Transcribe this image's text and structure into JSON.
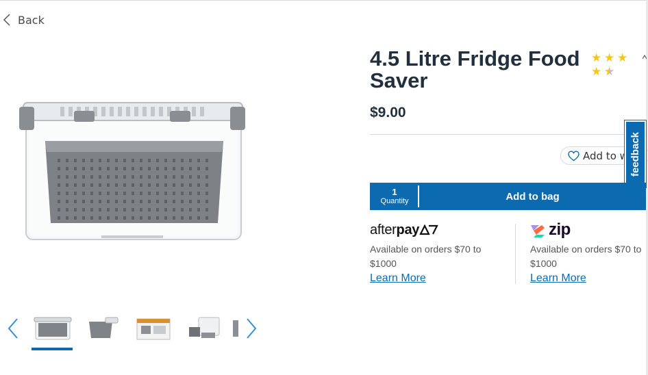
{
  "nav": {
    "back_label": "Back"
  },
  "product": {
    "title": "4.5 Litre Fridge Food Saver",
    "price": "$9.00",
    "rating": 4.5,
    "rating_max": 5,
    "image_icon": "food-container-image",
    "thumbnails": [
      {
        "icon": "container-front-thumbnail",
        "active": true
      },
      {
        "icon": "basket-thumbnail",
        "active": false
      },
      {
        "icon": "packaging-thumbnail",
        "active": false
      },
      {
        "icon": "parts-thumbnail",
        "active": false
      },
      {
        "icon": "partial-thumbnail",
        "active": false
      }
    ]
  },
  "wishlist": {
    "label": "Add to w",
    "icon": "heart-icon"
  },
  "feedback": {
    "label": "feedback"
  },
  "purchase": {
    "quantity_value": "1",
    "quantity_label": "Quantity",
    "add_to_bag_label": "Add to bag",
    "accent_color": "#0c6bb0"
  },
  "payments": {
    "afterpay": {
      "brand_light": "after",
      "brand_bold": "pay",
      "text": "Available on orders $70 to $1000",
      "link": "Learn More"
    },
    "zip": {
      "brand": "zip",
      "text": "Available on orders $70 to $1000",
      "link": "Learn More"
    }
  }
}
